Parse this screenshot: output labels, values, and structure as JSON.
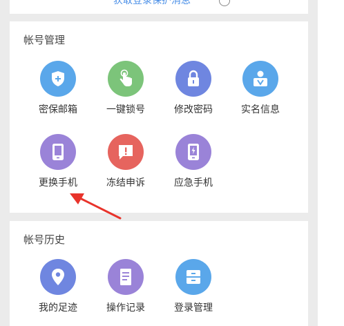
{
  "top": {
    "link_text": "获取登录保护消息"
  },
  "account_management": {
    "title": "帐号管理",
    "items": [
      {
        "label": "密保邮箱",
        "icon": "shield-plus-icon",
        "color": "#5aa7ea"
      },
      {
        "label": "一键锁号",
        "icon": "tap-hand-icon",
        "color": "#7cc47a"
      },
      {
        "label": "修改密码",
        "icon": "lock-icon",
        "color": "#6f86e0"
      },
      {
        "label": "实名信息",
        "icon": "id-card-icon",
        "color": "#5aa7ea"
      },
      {
        "label": "更换手机",
        "icon": "phone-icon",
        "color": "#9a83d8"
      },
      {
        "label": "冻结申诉",
        "icon": "alert-bubble-icon",
        "color": "#e6645e"
      },
      {
        "label": "应急手机",
        "icon": "emergency-phone-icon",
        "color": "#9a83d8"
      }
    ]
  },
  "account_history": {
    "title": "帐号历史",
    "items": [
      {
        "label": "我的足迹",
        "icon": "location-pin-icon",
        "color": "#6f86e0"
      },
      {
        "label": "操作记录",
        "icon": "document-icon",
        "color": "#9a83d8"
      },
      {
        "label": "登录管理",
        "icon": "drawer-icon",
        "color": "#5aa7ea"
      }
    ]
  },
  "annotation": {
    "arrow_color": "#e8332b"
  }
}
